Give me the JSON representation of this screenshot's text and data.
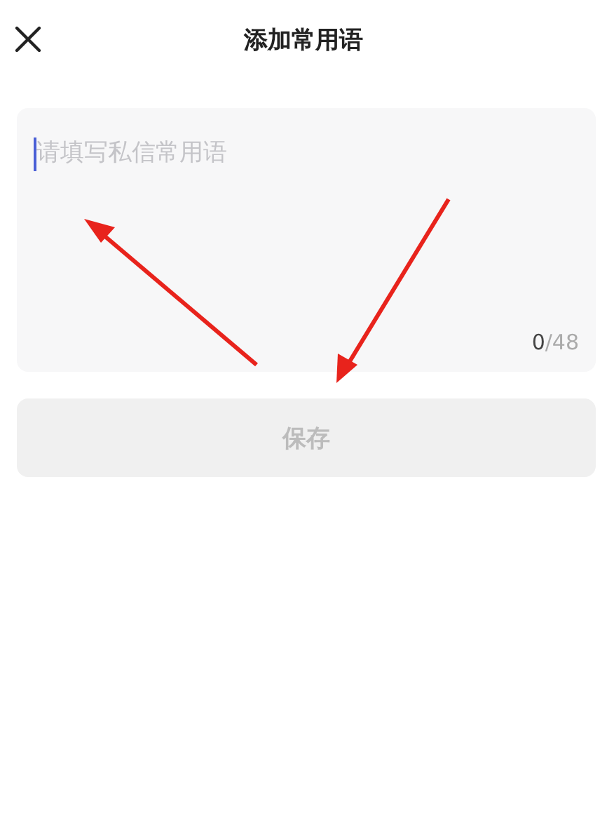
{
  "header": {
    "title": "添加常用语"
  },
  "message_field": {
    "placeholder": "请填写私信常用语",
    "focused": true
  },
  "counter": {
    "count": "0",
    "limit": "/48"
  },
  "save_button": {
    "label": "保存",
    "disabled": true
  }
}
